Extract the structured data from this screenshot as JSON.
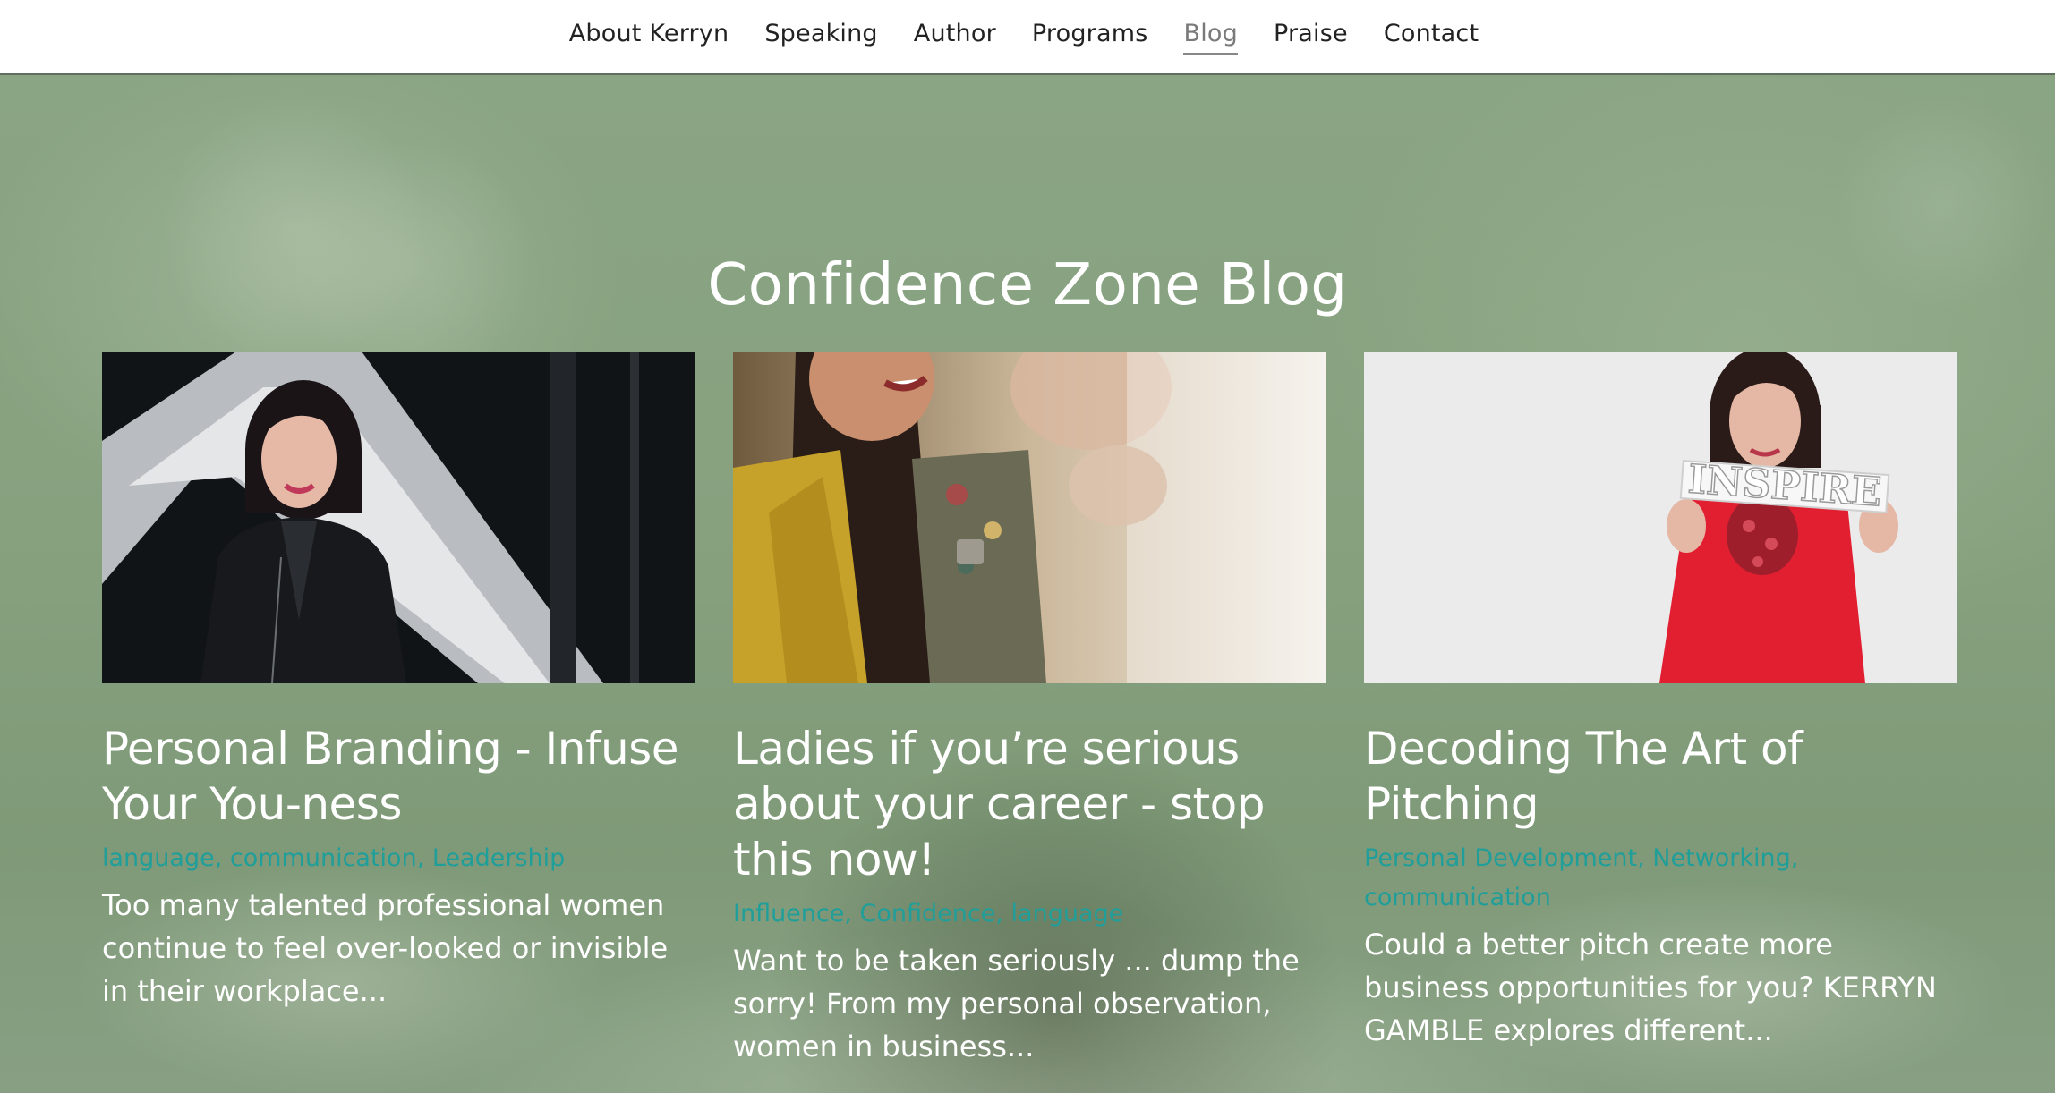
{
  "nav": {
    "items": [
      {
        "label": "About Kerryn"
      },
      {
        "label": "Speaking"
      },
      {
        "label": "Author"
      },
      {
        "label": "Programs"
      },
      {
        "label": "Blog",
        "active": true
      },
      {
        "label": "Praise"
      },
      {
        "label": "Contact"
      }
    ]
  },
  "page": {
    "title": "Confidence Zone Blog"
  },
  "posts": [
    {
      "title": "Personal Branding - Infuse Your You-ness",
      "categories": [
        "language",
        "communication",
        "Leadership"
      ],
      "excerpt": "Too many talented professional women continue to feel over-looked or invisible in their workplace..."
    },
    {
      "title": "Ladies if you’re serious about your career - stop this now!",
      "categories": [
        "Influence",
        "Confidence",
        "language"
      ],
      "excerpt": "Want to be taken seriously ... dump the sorry! From my personal observation, women in business..."
    },
    {
      "title": "Decoding The Art of Pitching",
      "categories": [
        "Personal Development",
        "Networking",
        "communication"
      ],
      "excerpt": "Could a better pitch create more business opportunities for you? KERRYN GAMBLE explores different...",
      "image_text": "INSPIRE"
    }
  ],
  "colors": {
    "category_link": "#1f9e9a",
    "hero_green": "#8aa482",
    "nav_active": "#7a7a7a"
  }
}
